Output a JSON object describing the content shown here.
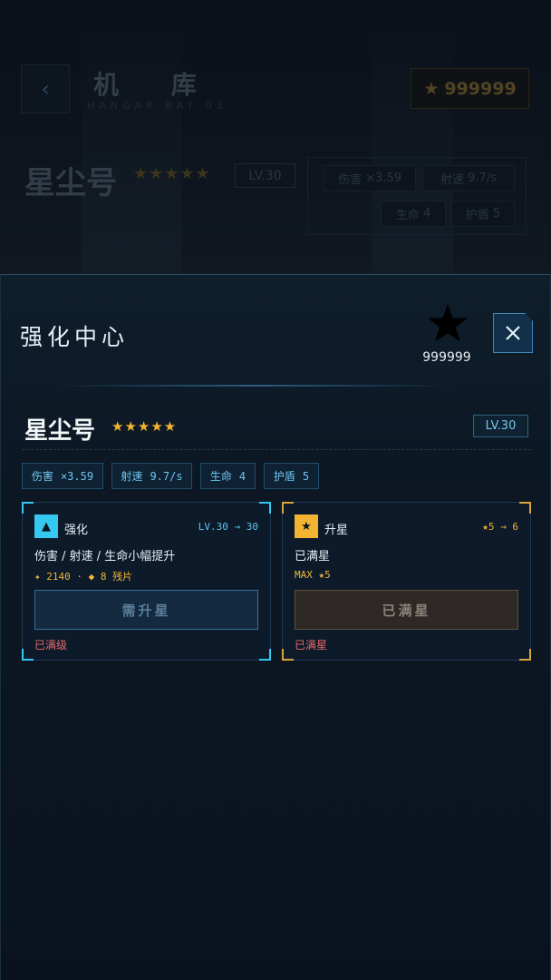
{
  "background": {
    "back_icon": "chevron-left-icon",
    "title": "机 库",
    "subtitle": "HANGAR BAY 03",
    "currency_icon": "star-icon",
    "currency_value": "999999",
    "ship_name": "星尘号",
    "ship_stars": "★★★★★",
    "level": "LV.30",
    "stats": [
      {
        "label": "伤害",
        "value": "×3.59"
      },
      {
        "label": "射速",
        "value": "9.7/s"
      },
      {
        "label": "生命",
        "value": "4"
      },
      {
        "label": "护盾",
        "value": "5"
      }
    ]
  },
  "sheet": {
    "title": "强化中心",
    "currency_icon": "star-icon",
    "currency_value": "999999",
    "close_icon": "close-icon",
    "ship_name": "星尘号",
    "ship_stars": "★★★★★",
    "level": "LV.30",
    "stats": [
      {
        "label": "伤害",
        "value": "×3.59"
      },
      {
        "label": "射速",
        "value": "9.7/s"
      },
      {
        "label": "生命",
        "value": "4"
      },
      {
        "label": "护盾",
        "value": "5"
      }
    ],
    "cards": {
      "enhance": {
        "icon": "▲",
        "name": "强化",
        "level": "LV.30 → 30",
        "desc": "伤害 / 射速 / 生命小幅提升",
        "cost": "✦ 2140 · ◆ 8 残片",
        "button": "需升星",
        "status": "已满级"
      },
      "star_up": {
        "icon": "★",
        "name": "升星",
        "level": "★5 → 6",
        "desc": "已满星",
        "cost": "MAX ★5",
        "button": "已满星",
        "status": "已满星"
      }
    },
    "colors": {
      "accent_blue": "#35c8f0",
      "accent_gold": "#f2b431",
      "warning_red": "#e86a6a"
    }
  }
}
